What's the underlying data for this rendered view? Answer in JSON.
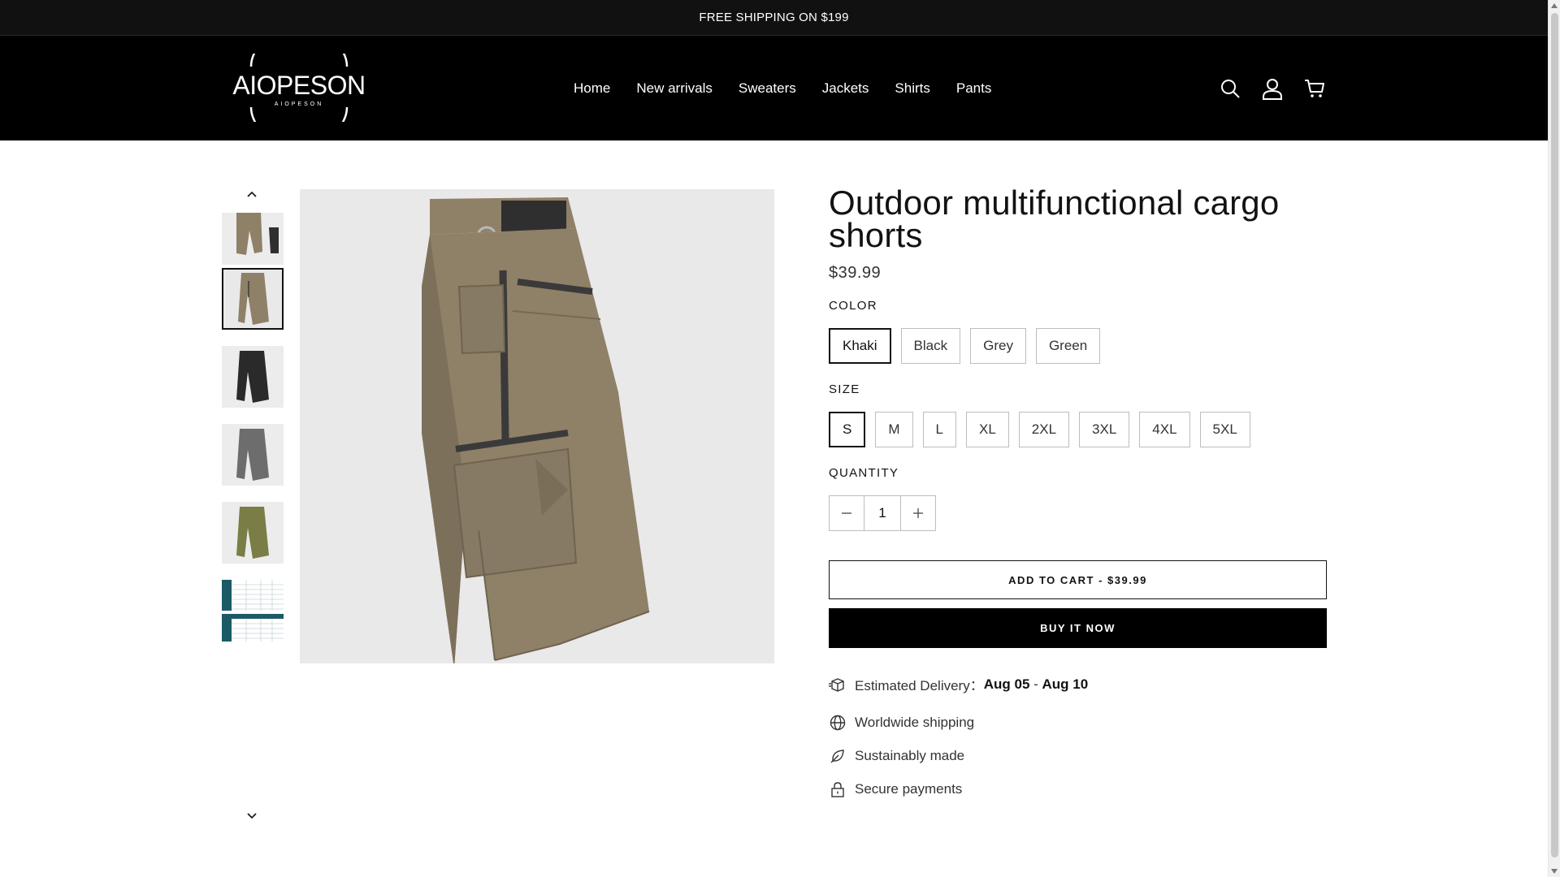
{
  "announcement": "FREE SHIPPING ON $199",
  "header": {
    "logo_text": "AIOPESON",
    "logo_subtext": "AIOPESON",
    "nav": [
      "Home",
      "New arrivals",
      "Sweaters",
      "Jackets",
      "Shirts",
      "Pants"
    ],
    "icons": [
      "search-icon",
      "account-icon",
      "cart-icon"
    ]
  },
  "gallery": {
    "thumbnails": [
      {
        "color": "khaki",
        "selected": false
      },
      {
        "color": "khaki",
        "selected": true
      },
      {
        "color": "black",
        "selected": false
      },
      {
        "color": "grey",
        "selected": false
      },
      {
        "color": "green",
        "selected": false
      },
      {
        "color": "size-chart",
        "selected": false
      }
    ]
  },
  "product": {
    "title": "Outdoor multifunctional cargo shorts",
    "price": "$39.99",
    "color_label": "COLOR",
    "colors": [
      "Khaki",
      "Black",
      "Grey",
      "Green"
    ],
    "selected_color": "Khaki",
    "size_label": "SIZE",
    "sizes": [
      "S",
      "M",
      "L",
      "XL",
      "2XL",
      "3XL",
      "4XL",
      "5XL"
    ],
    "selected_size": "S",
    "quantity_label": "QUANTITY",
    "quantity": "1",
    "add_to_cart": "ADD TO CART - $39.99",
    "buy_now": "BUY IT NOW"
  },
  "features": {
    "delivery_label": "Estimated Delivery：",
    "delivery_from": "Aug 05",
    "delivery_sep": " - ",
    "delivery_to": "Aug 10",
    "worldwide": "Worldwide shipping",
    "sustainable": "Sustainably made",
    "secure": "Secure payments"
  },
  "colors": {
    "announcement_bg": "#111111",
    "header_bg": "#000000",
    "khaki": "#8f8068",
    "black_variant": "#2a2a2a",
    "grey_variant": "#6d6d6d",
    "green_variant": "#7a7d45",
    "chart_teal": "#1c5a66"
  }
}
